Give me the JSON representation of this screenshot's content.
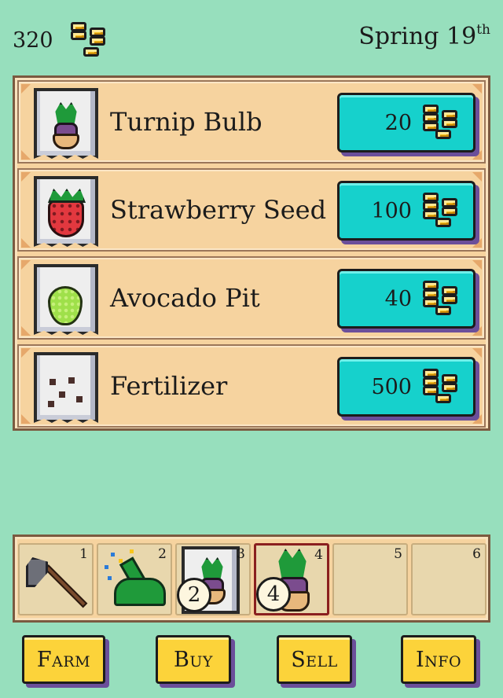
{
  "header": {
    "gold": "320",
    "season": "Spring",
    "day": "19",
    "day_suffix": "th",
    "gold_icon": "coin-stack-icon"
  },
  "shop": {
    "items": [
      {
        "name": "Turnip Bulb",
        "price": "20",
        "icon": "turnip-packet-icon"
      },
      {
        "name": "Strawberry Seed",
        "price": "100",
        "icon": "strawberry-packet-icon"
      },
      {
        "name": "Avocado Pit",
        "price": "40",
        "icon": "avocado-packet-icon"
      },
      {
        "name": "Fertilizer",
        "price": "500",
        "icon": "fertilizer-bag-icon"
      }
    ]
  },
  "toolbar": {
    "slots": [
      {
        "number": "1",
        "icon": "hoe-icon",
        "quantity": ""
      },
      {
        "number": "2",
        "icon": "watering-can-icon",
        "quantity": ""
      },
      {
        "number": "3",
        "icon": "turnip-packet-icon",
        "quantity": "2"
      },
      {
        "number": "4",
        "icon": "turnip-icon",
        "quantity": "4",
        "selected": true
      },
      {
        "number": "5",
        "icon": "",
        "quantity": ""
      },
      {
        "number": "6",
        "icon": "",
        "quantity": ""
      }
    ]
  },
  "nav": {
    "farm": "Farm",
    "buy": "Buy",
    "sell": "Sell",
    "info": "Info"
  },
  "colors": {
    "background": "#97dfbd",
    "panel": "#f6d39f",
    "price_button": "#16d1cc",
    "nav_button": "#fcd33a",
    "button_shadow": "#6b4f9a"
  }
}
